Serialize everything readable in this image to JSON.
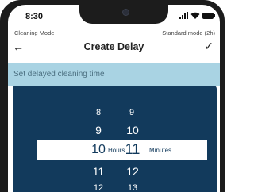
{
  "status_bar": {
    "time": "8:30"
  },
  "header": {
    "mode_left": "Cleaning Mode",
    "mode_right": "Standard mode (2h)",
    "title": "Create Delay",
    "back_icon": "back-arrow-icon",
    "confirm_icon": "checkmark-icon"
  },
  "info_text": "Set delayed cleaning time",
  "picker": {
    "hours": [
      "8",
      "9",
      "10",
      "11",
      "12"
    ],
    "minutes": [
      "9",
      "10",
      "11",
      "12",
      "13"
    ],
    "selected_hour": "10",
    "selected_minute": "11",
    "hours_label": "Hours",
    "minutes_label": "Minutes"
  },
  "colors": {
    "accent": "#a9d3e3",
    "panel": "#123a5c"
  }
}
